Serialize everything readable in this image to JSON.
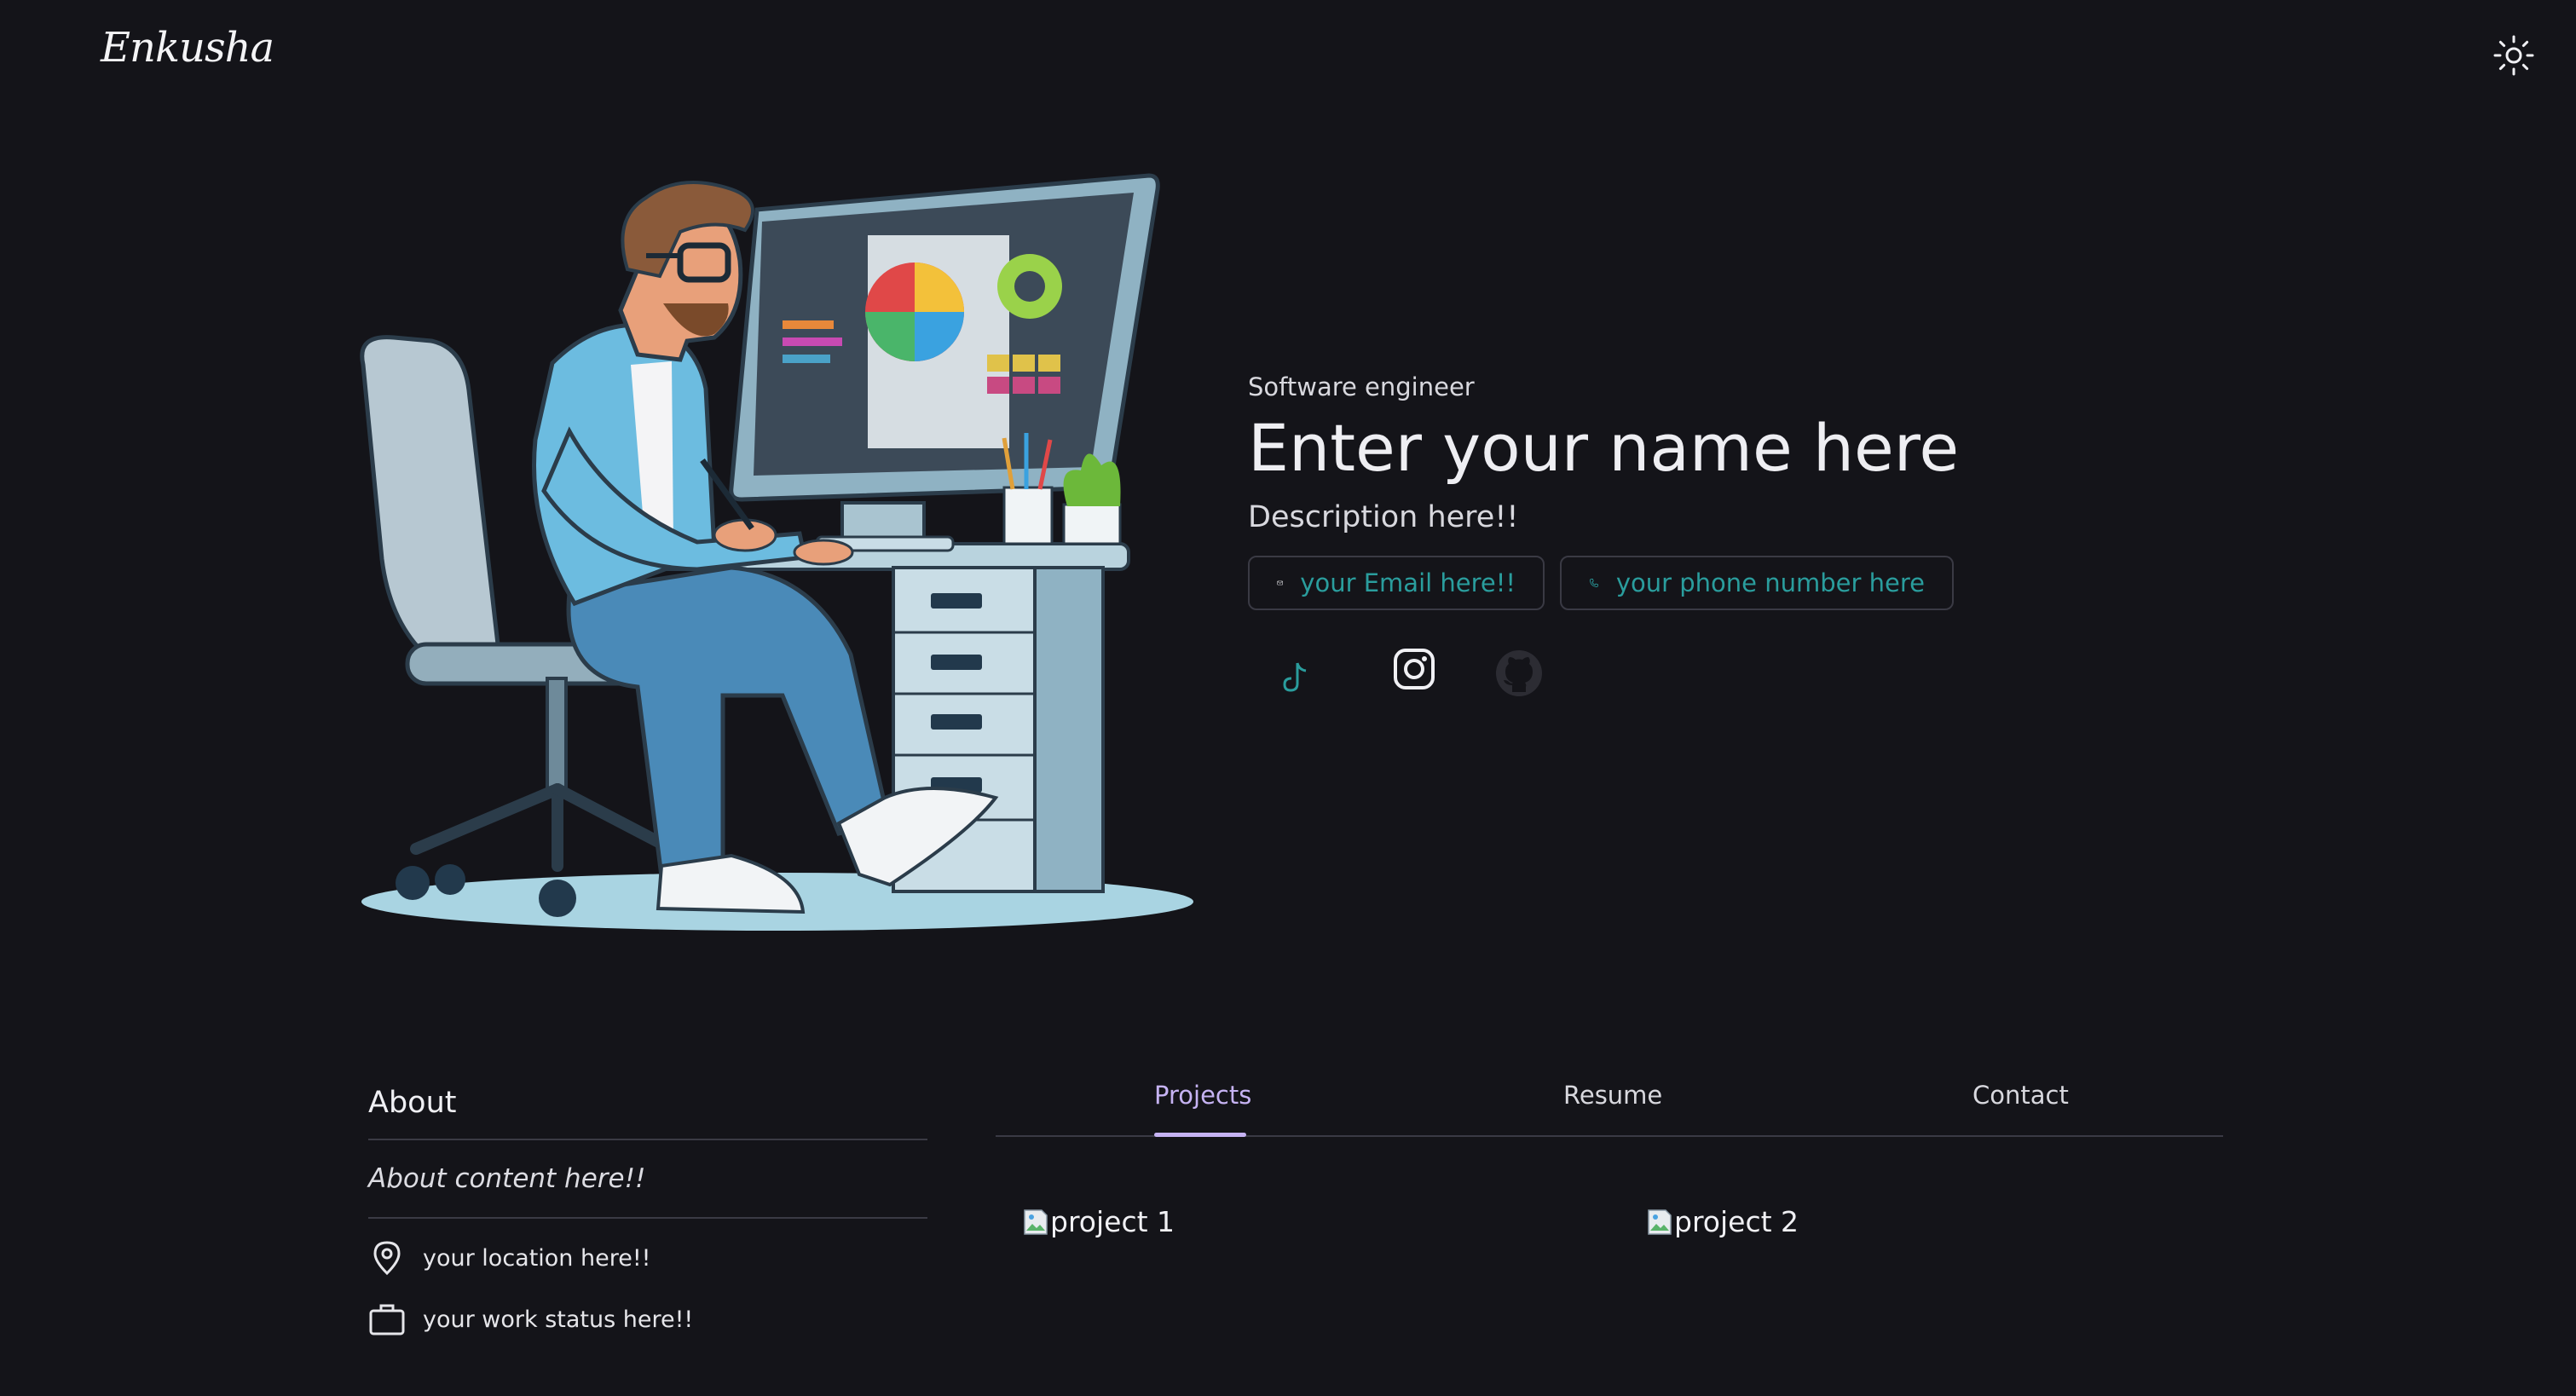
{
  "header": {
    "logo_text": "Enkusha",
    "theme_toggle_icon": "sun-icon"
  },
  "hero": {
    "role": "Software engineer",
    "name": "Enter your name here",
    "description": "Description here!!",
    "email_label": "your Email here!!",
    "phone_label": "your phone number here",
    "email_icon": "mail-icon",
    "phone_icon": "phone-icon",
    "socials": [
      "tiktok-icon",
      "instagram-icon",
      "github-icon"
    ]
  },
  "about": {
    "heading": "About",
    "content": "About content here!!",
    "location": "your location here!!",
    "work_status": "your work status here!!"
  },
  "tabs": {
    "items": [
      "Projects",
      "Resume",
      "Contact"
    ],
    "active": "Projects"
  },
  "projects": [
    {
      "alt": "project 1"
    },
    {
      "alt": "project 2"
    }
  ],
  "colors": {
    "background": "#141419",
    "accent_teal": "#2a9d9d",
    "accent_purple": "#c6b3f3",
    "divider": "#3a3a44"
  }
}
